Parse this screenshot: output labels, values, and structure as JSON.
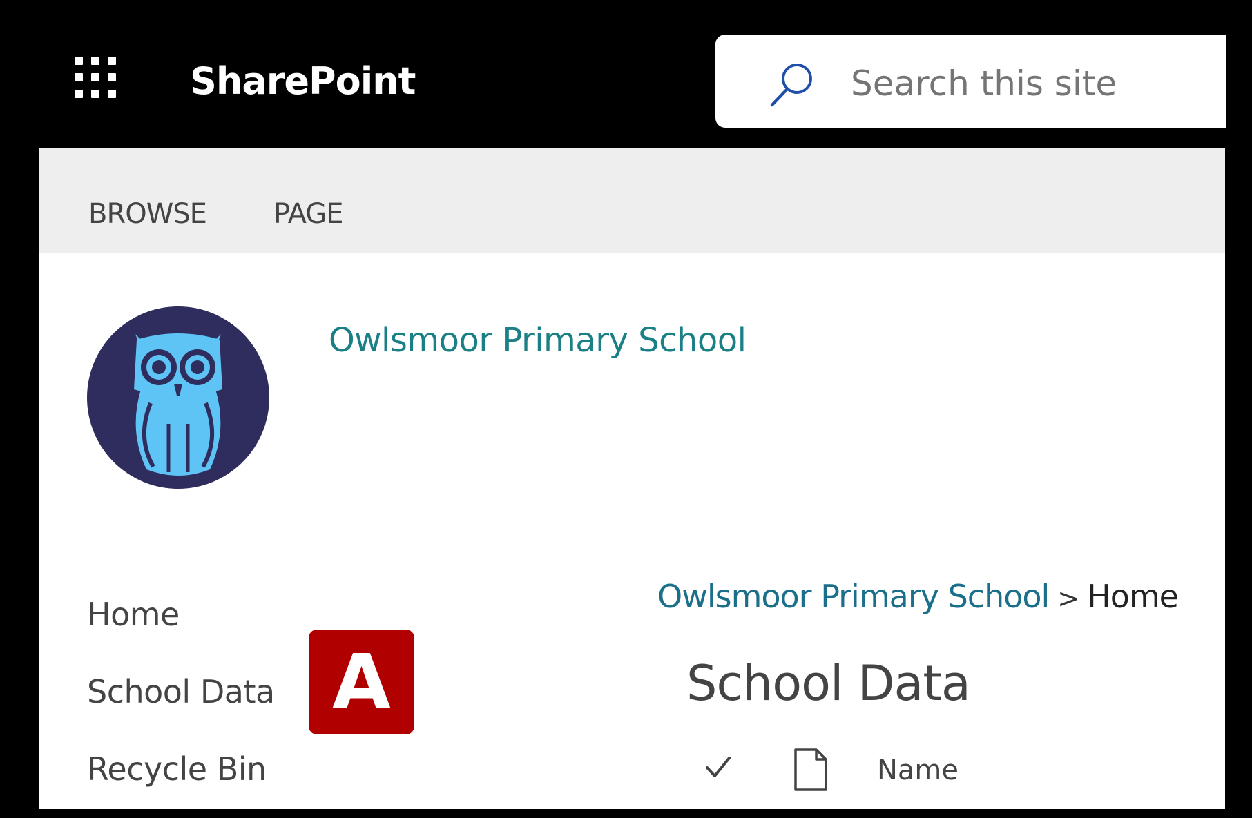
{
  "suite_bar": {
    "app_title": "SharePoint",
    "search_placeholder": "Search this site"
  },
  "ribbon": {
    "tabs": [
      {
        "label": "BROWSE"
      },
      {
        "label": "PAGE"
      }
    ]
  },
  "site": {
    "title": "Owlsmoor Primary School",
    "logo_icon": "owl-logo-icon",
    "logo_colors": {
      "background": "#2e2d5e",
      "owl": "#5ec4f5"
    }
  },
  "left_nav": {
    "items": [
      {
        "label": "Home"
      },
      {
        "label": "School Data"
      },
      {
        "label": "Recycle Bin"
      }
    ]
  },
  "badge": {
    "label": "A",
    "color": "#b00000"
  },
  "breadcrumb": {
    "site": "Owlsmoor Primary School",
    "separator": ">",
    "current": "Home"
  },
  "list": {
    "title": "School Data",
    "columns": {
      "select_icon": "checkmark-icon",
      "type_icon": "document-icon",
      "name": "Name"
    }
  }
}
